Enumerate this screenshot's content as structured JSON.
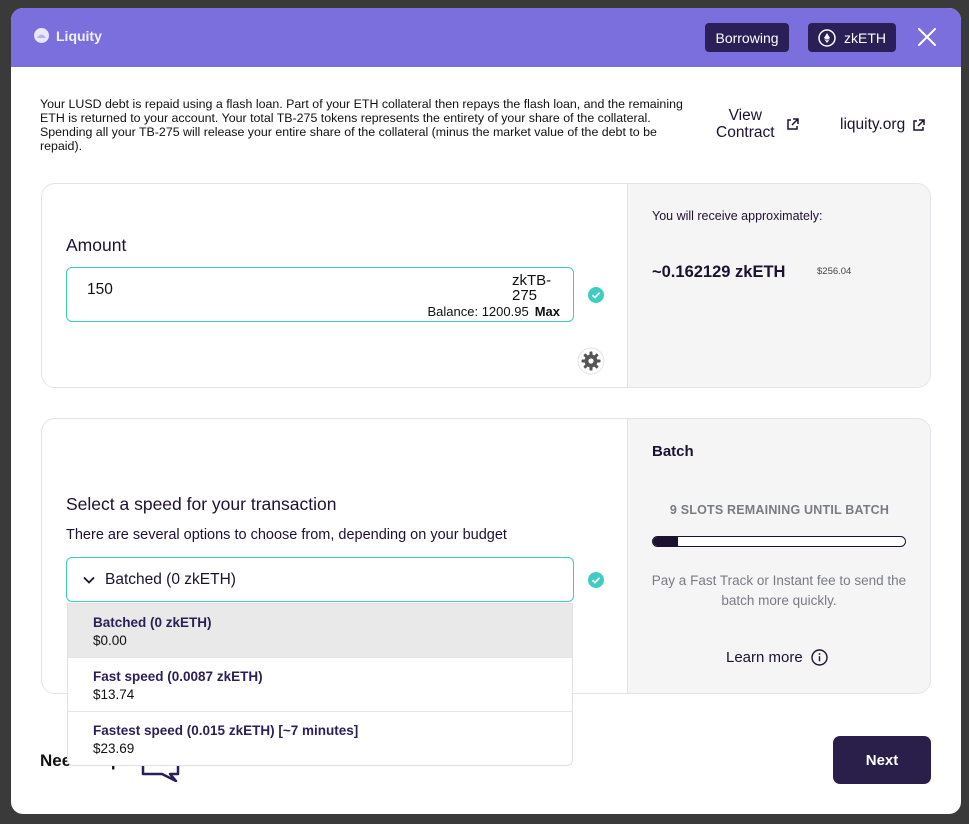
{
  "header": {
    "brand": "Liquity",
    "borrowing_label": "Borrowing",
    "network_label": "zkETH"
  },
  "description": "Your LUSD debt is repaid using a flash loan. Part of your ETH collateral then repays the flash loan, and the remaining ETH is returned to your account. Your total TB-275 tokens represents the entirety of your share of the collateral. Spending all your TB-275 will release your entire share of the collateral (minus the market value of the debt to be repaid).",
  "links": {
    "view_contract_line1": "View",
    "view_contract_line2": "Contract",
    "site": "liquity.org"
  },
  "amount": {
    "label": "Amount",
    "value": "150",
    "token_line1": "zkTB-",
    "token_line2": "275",
    "balance": "Balance: 1200.95",
    "max_label": "Max"
  },
  "receive": {
    "label": "You will receive approximately:",
    "amount": "~0.162129 zkETH",
    "usd": "$256.04"
  },
  "speed": {
    "title": "Select a speed for your transaction",
    "subtitle": "There are several options to choose from, depending on your budget",
    "selected": "Batched (0 zkETH)",
    "options": [
      {
        "name": "Batched (0 zkETH)",
        "price": "$0.00"
      },
      {
        "name": "Fast speed (0.0087 zkETH)",
        "price": "$13.74"
      },
      {
        "name": "Fastest speed (0.015 zkETH) [~7 minutes]",
        "price": "$23.69"
      }
    ]
  },
  "batch": {
    "title": "Batch",
    "slots": "9 SLOTS REMAINING UNTIL BATCH",
    "progress_fraction": 0.1,
    "note": "Pay a Fast Track or Instant fee to send the batch more quickly.",
    "learn_more": "Learn more"
  },
  "footer": {
    "help": "Need help?",
    "next_label": "Next"
  },
  "colors": {
    "header_bg": "#7b6fdd",
    "accent_teal": "#3ecdc3",
    "dark_button": "#2a1f4a"
  }
}
